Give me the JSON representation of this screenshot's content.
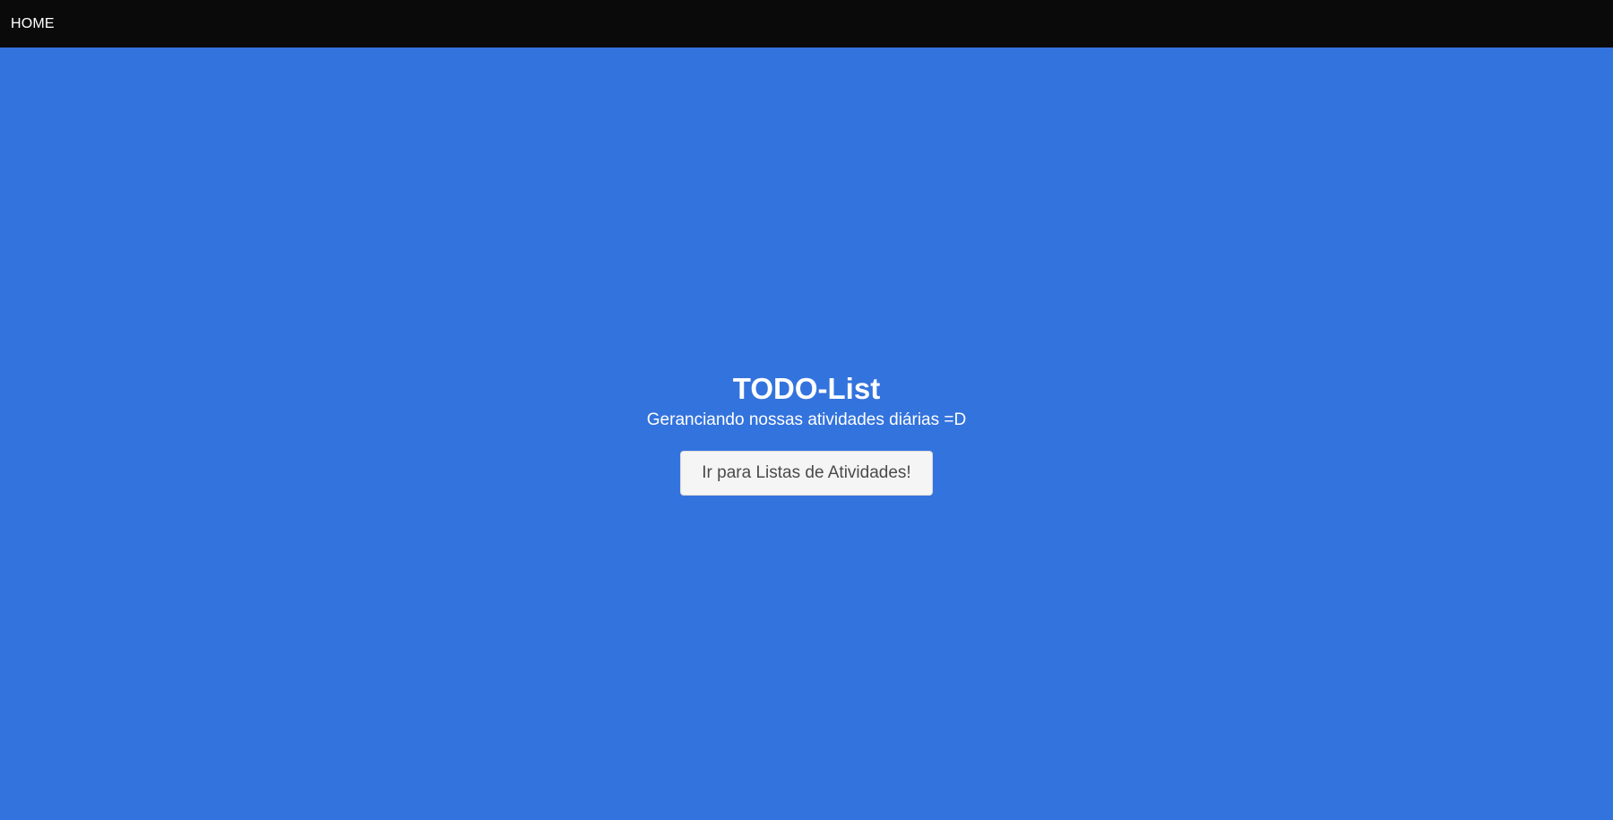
{
  "navbar": {
    "home_label": "HOME"
  },
  "hero": {
    "title": "TODO-List",
    "subtitle": "Geranciando nossas atividades diárias =D",
    "button_label": "Ir para Listas de Atividades!"
  },
  "colors": {
    "navbar_background": "#0a0a0a",
    "page_background": "#3373dd",
    "button_background": "#f5f5f5",
    "button_text": "#4a4a4a",
    "text_on_blue": "#ffffff"
  }
}
